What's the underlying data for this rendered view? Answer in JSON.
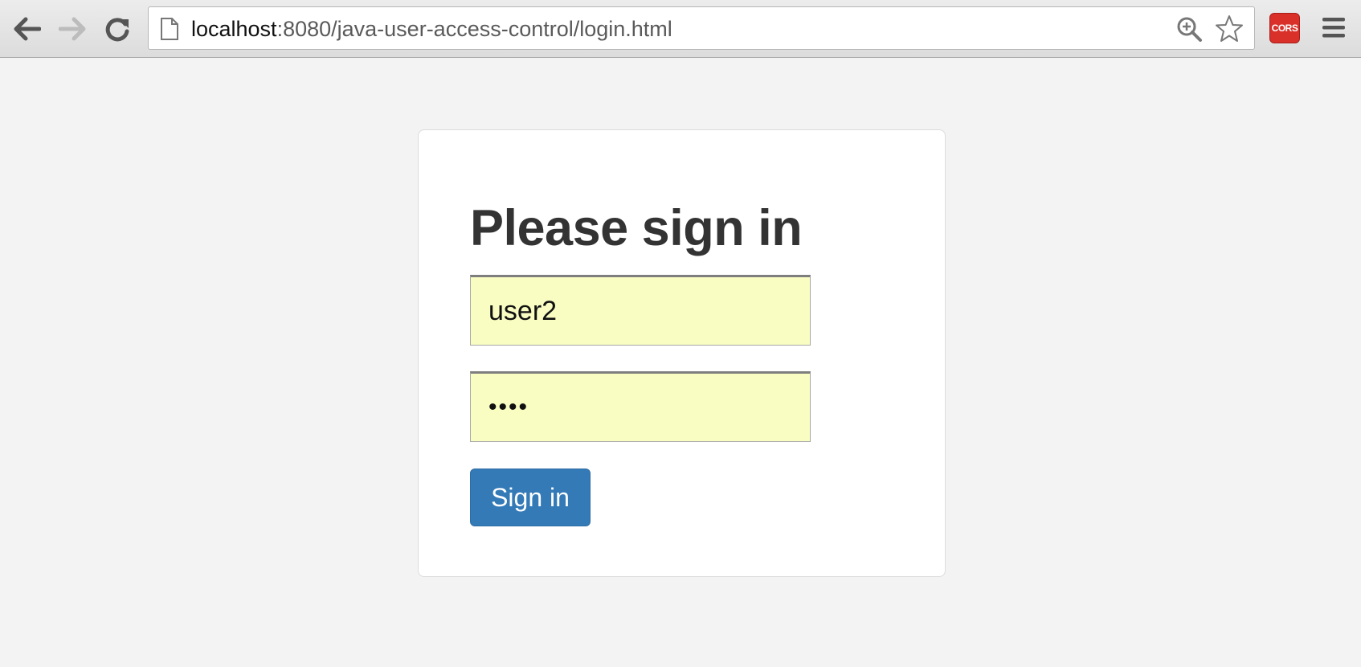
{
  "browser": {
    "url_host": "localhost",
    "url_rest": ":8080/java-user-access-control/login.html",
    "extension_label": "CORS"
  },
  "login": {
    "heading": "Please sign in",
    "username_value": "user2",
    "password_value": "••••",
    "submit_label": "Sign in"
  },
  "colors": {
    "primary_button": "#337ab7",
    "autofill_bg": "#f9fdc2",
    "cors_badge": "#d9302a"
  }
}
